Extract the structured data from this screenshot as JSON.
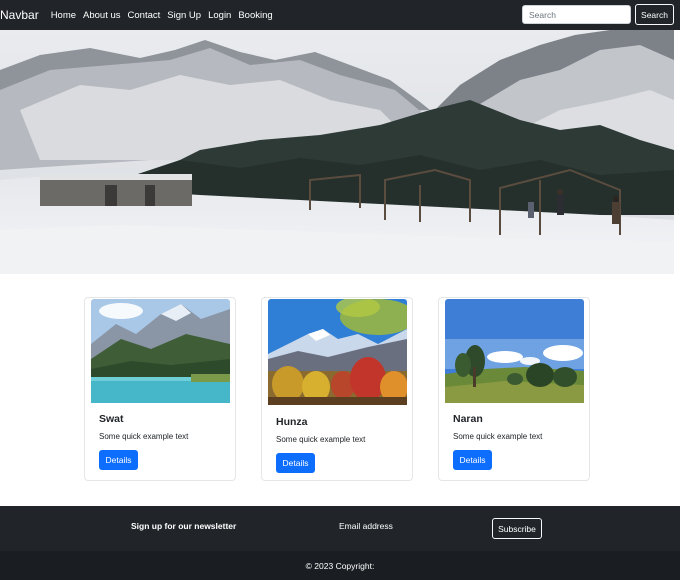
{
  "navbar": {
    "brand": "Navbar",
    "links": [
      "Home",
      "About us",
      "Contact",
      "Sign Up",
      "Login",
      "Booking"
    ],
    "search_placeholder": "Search",
    "search_button": "Search"
  },
  "cards": [
    {
      "title": "Swat",
      "text": "Some quick example text",
      "button": "Details"
    },
    {
      "title": "Hunza",
      "text": "Some quick example text",
      "button": "Details"
    },
    {
      "title": "Naran",
      "text": "Some quick example text",
      "button": "Details"
    }
  ],
  "footer": {
    "newsletter_label": "Sign up for our newsletter",
    "email_label": "Email address",
    "subscribe_button": "Subscribe",
    "copyright": "© 2023 Copyright:"
  },
  "colors": {
    "navbar_bg": "#212529",
    "primary": "#0d6efd",
    "footer_bg": "#212529"
  }
}
